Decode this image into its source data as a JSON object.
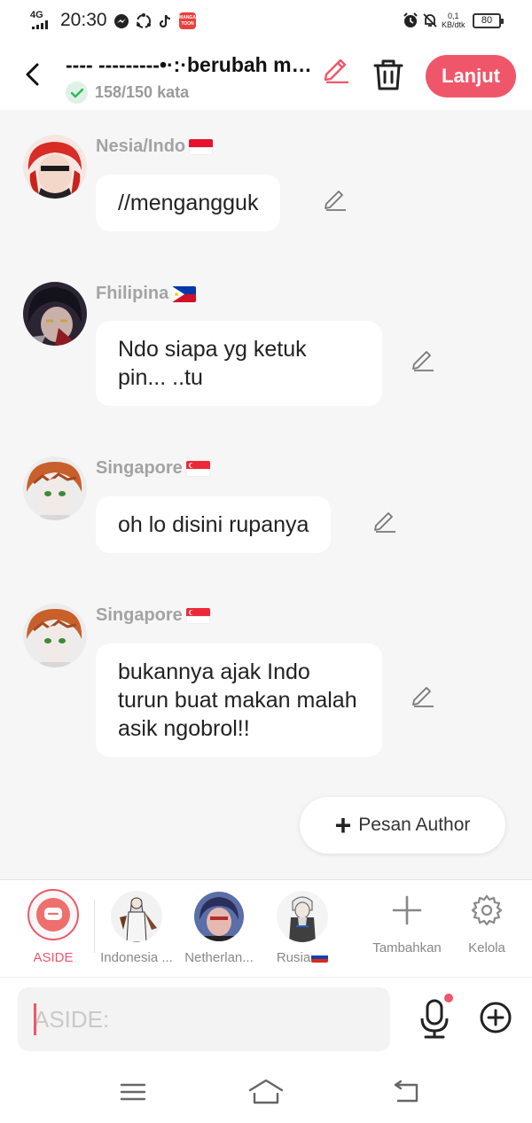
{
  "status_bar": {
    "network": "4G",
    "time": "20:30",
    "app_badge": "MANGA TOON",
    "speed_value": "0,1",
    "speed_unit": "KB/dtk",
    "battery": "80"
  },
  "header": {
    "title": "---- ---------•·:·berubah me...",
    "word_count": "158/150 kata",
    "next_button": "Lanjut"
  },
  "messages": [
    {
      "name": "Nesia/Indo",
      "flag": "indonesia",
      "text": "//mengangguk"
    },
    {
      "name": "Fhilipina",
      "flag": "philippines",
      "text": "Ndo siapa yg ketuk pin... ..tu"
    },
    {
      "name": "Singapore",
      "flag": "singapore",
      "text": "oh lo disini rupanya"
    },
    {
      "name": "Singapore",
      "flag": "singapore",
      "text": "bukannya ajak Indo turun buat makan malah asik ngobrol!!"
    }
  ],
  "pesan_author": "Pesan Author",
  "characters": {
    "aside": "ASIDE",
    "items": [
      "Indonesia ...",
      "Netherlan...",
      "Rusia"
    ],
    "add_label": "Tambahkan",
    "manage_label": "Kelola"
  },
  "input": {
    "placeholder": "ASIDE:"
  },
  "colors": {
    "accent": "#f0566a",
    "background": "#f6f6f6",
    "bubble": "#ffffff",
    "name_gray": "#a3a3a3",
    "check_green": "#32b55a"
  }
}
